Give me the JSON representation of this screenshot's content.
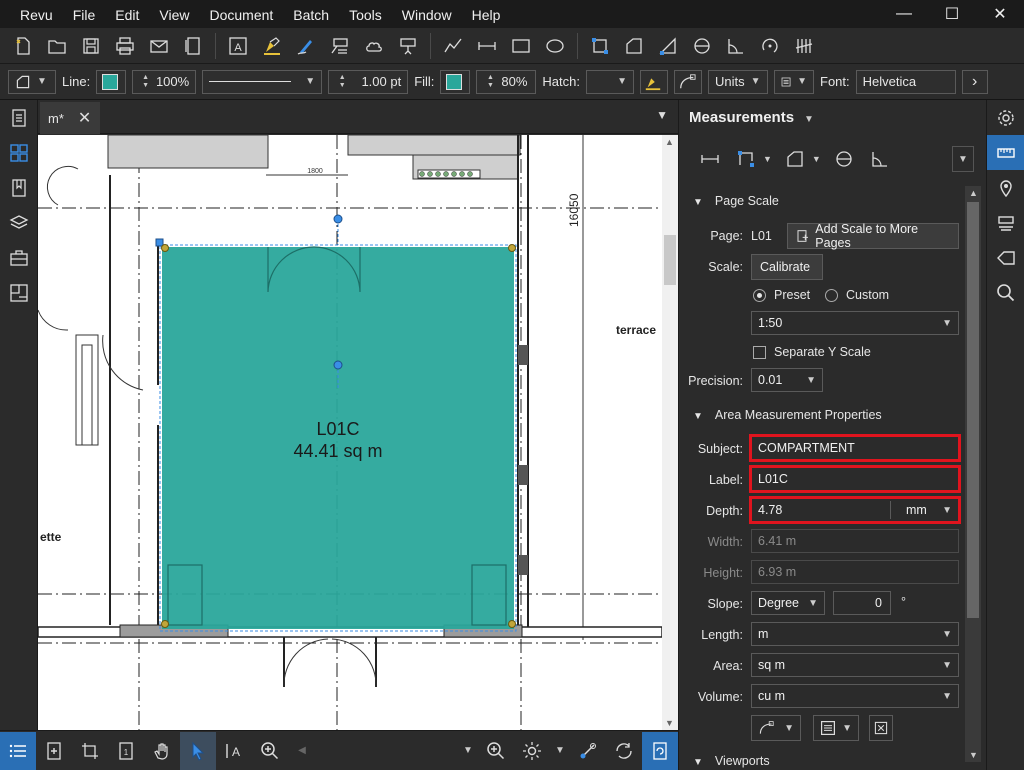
{
  "menu": [
    "Revu",
    "File",
    "Edit",
    "View",
    "Document",
    "Batch",
    "Tools",
    "Window",
    "Help"
  ],
  "window_controls": {
    "minimize": "—",
    "maximize": "☐",
    "close": "✕"
  },
  "props_toolbar": {
    "line_label": "Line:",
    "line_opacity": "100%",
    "line_width": "1.00 pt",
    "fill_label": "Fill:",
    "fill_opacity": "80%",
    "hatch_label": "Hatch:",
    "units_label": "Units",
    "font_label": "Font:",
    "font_value": "Helvetica",
    "more": "›"
  },
  "document_tab": {
    "title": "m*",
    "close": "✕"
  },
  "canvas": {
    "area_label": "L01C",
    "area_value": "44.41 sq m",
    "dimension": "16050",
    "small_dim": "1800",
    "text_terrace": "terrace",
    "text_ette": "ette"
  },
  "panel": {
    "title": "Measurements",
    "page_scale": {
      "header": "Page Scale",
      "page_label": "Page:",
      "page_value": "L01",
      "add_scale_button": "Add Scale to More Pages",
      "scale_label": "Scale:",
      "calibrate_button": "Calibrate",
      "preset_label": "Preset",
      "custom_label": "Custom",
      "preset_value": "1:50",
      "separate_y": "Separate Y Scale",
      "precision_label": "Precision:",
      "precision_value": "0.01"
    },
    "area_props": {
      "header": "Area Measurement Properties",
      "subject_label": "Subject:",
      "subject_value": "COMPARTMENT",
      "label_label": "Label:",
      "label_value": "L01C",
      "depth_label": "Depth:",
      "depth_value": "4.78",
      "depth_unit": "mm",
      "width_label": "Width:",
      "width_value": "6.41 m",
      "height_label": "Height:",
      "height_value": "6.93 m",
      "slope_label": "Slope:",
      "slope_unit": "Degree",
      "slope_value": "0",
      "slope_symbol": "°",
      "length_label": "Length:",
      "length_value": "m",
      "area_label": "Area:",
      "area_value": "sq m",
      "volume_label": "Volume:",
      "volume_value": "cu m"
    },
    "next_section": "Viewports"
  },
  "colors": {
    "accent": "#2a6fb5",
    "area_fill": "#2aa79b",
    "highlight": "#e0141e"
  }
}
